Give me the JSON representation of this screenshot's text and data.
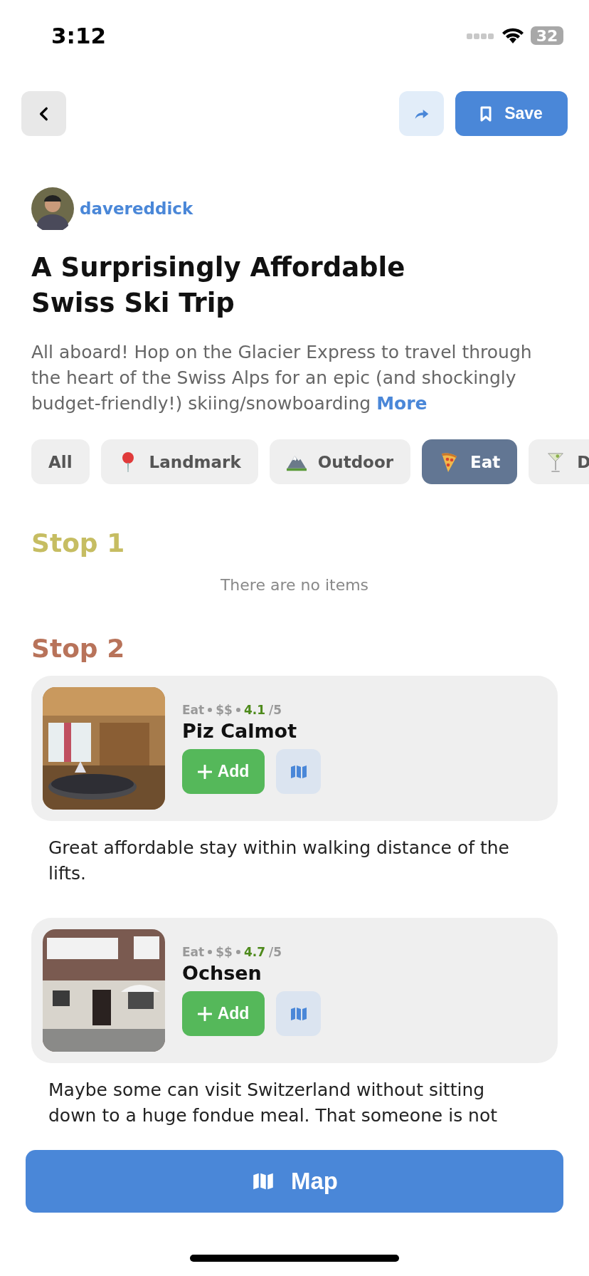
{
  "status_bar": {
    "time": "3:12",
    "battery": "32"
  },
  "header": {
    "save_label": "Save"
  },
  "author": {
    "username": "davereddick"
  },
  "title": "A Surprisingly Affordable Swiss Ski Trip",
  "description": {
    "text": "All aboard! Hop on the Glacier Express to travel through the heart of the Swiss Alps for an epic (and shockingly budget-friendly!) skiing/snowboarding",
    "more_label": "More"
  },
  "filters": [
    {
      "label": "All",
      "kind": "plain",
      "selected": false
    },
    {
      "label": "Landmark",
      "kind": "pin",
      "selected": false
    },
    {
      "label": "Outdoor",
      "kind": "mountain",
      "selected": false
    },
    {
      "label": "Eat",
      "kind": "pizza",
      "selected": true
    },
    {
      "label": "D",
      "kind": "cocktail",
      "selected": false
    }
  ],
  "stops": [
    {
      "heading": "Stop 1",
      "color": "#c6bd62",
      "empty_text": "There are no items"
    },
    {
      "heading": "Stop 2",
      "color": "#b8735a",
      "items": [
        {
          "category": "Eat",
          "price": "$$",
          "rating": "4.1",
          "rating_scale": "/5",
          "name": "Piz Calmot",
          "add_label": "Add",
          "note": "Great affordable stay within walking distance of the lifts."
        },
        {
          "category": "Eat",
          "price": "$$",
          "rating": "4.7",
          "rating_scale": "/5",
          "name": "Ochsen",
          "add_label": "Add",
          "note": "Maybe some can visit Switzerland without sitting down to a huge fondue meal. That someone is not"
        }
      ]
    }
  ],
  "map_button": {
    "label": "Map"
  }
}
